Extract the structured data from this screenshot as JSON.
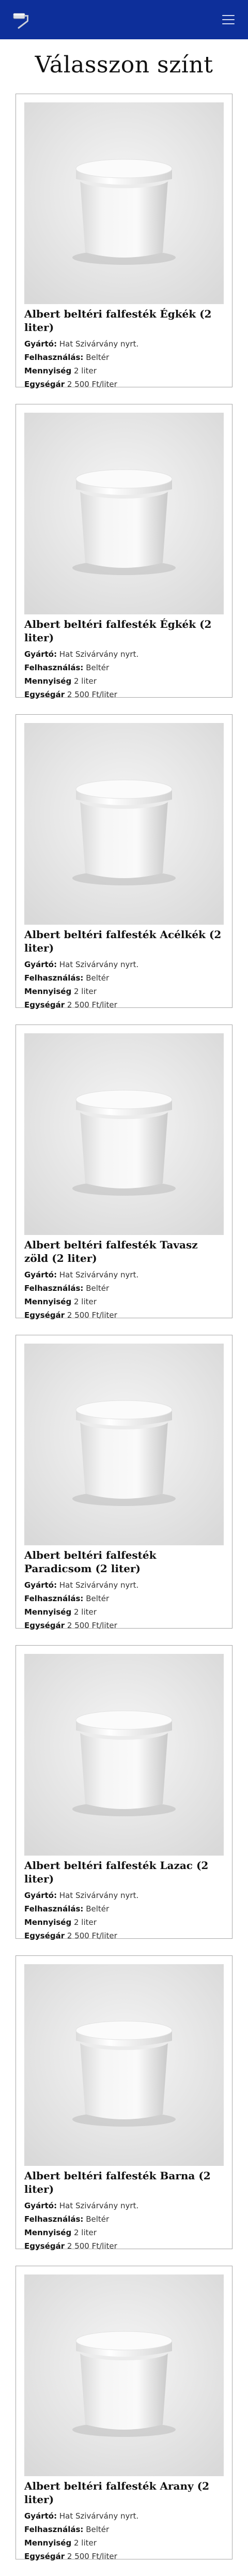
{
  "header": {
    "logo_icon": "paint-roller-icon",
    "menu_icon": "hamburger-menu-icon",
    "accent_color": "#0d2f9a"
  },
  "page": {
    "title": "Válasszon színt"
  },
  "labels": {
    "manufacturer": "Gyártó:",
    "usage": "Felhasználás:",
    "quantity": "Mennyiség",
    "unit_price": "Egységár"
  },
  "products": [
    {
      "title": "Albert beltéri falfesték Égkék (2 liter)",
      "manufacturer": "Hat Szivárvány nyrt.",
      "usage": "Beltér",
      "quantity": "2 liter",
      "unit_price": "2 500 Ft/liter"
    },
    {
      "title": "Albert beltéri falfesték Égkék (2 liter)",
      "manufacturer": "Hat Szivárvány nyrt.",
      "usage": "Beltér",
      "quantity": "2 liter",
      "unit_price": "2 500 Ft/liter"
    },
    {
      "title": "Albert beltéri falfesték Acélkék (2 liter)",
      "manufacturer": "Hat Szivárvány nyrt.",
      "usage": "Beltér",
      "quantity": "2 liter",
      "unit_price": "2 500 Ft/liter"
    },
    {
      "title": "Albert beltéri falfesték Tavasz zöld (2 liter)",
      "manufacturer": "Hat Szivárvány nyrt.",
      "usage": "Beltér",
      "quantity": "2 liter",
      "unit_price": "2 500 Ft/liter"
    },
    {
      "title": "Albert beltéri falfesték Paradicsom (2 liter)",
      "manufacturer": "Hat Szivárvány nyrt.",
      "usage": "Beltér",
      "quantity": "2 liter",
      "unit_price": "2 500 Ft/liter"
    },
    {
      "title": "Albert beltéri falfesték Lazac (2 liter)",
      "manufacturer": "Hat Szivárvány nyrt.",
      "usage": "Beltér",
      "quantity": "2 liter",
      "unit_price": "2 500 Ft/liter"
    },
    {
      "title": "Albert beltéri falfesték Barna (2 liter)",
      "manufacturer": "Hat Szivárvány nyrt.",
      "usage": "Beltér",
      "quantity": "2 liter",
      "unit_price": "2 500 Ft/liter"
    },
    {
      "title": "Albert beltéri falfesték Arany (2 liter)",
      "manufacturer": "Hat Szivárvány nyrt.",
      "usage": "Beltér",
      "quantity": "2 liter",
      "unit_price": "2 500 Ft/liter"
    }
  ]
}
